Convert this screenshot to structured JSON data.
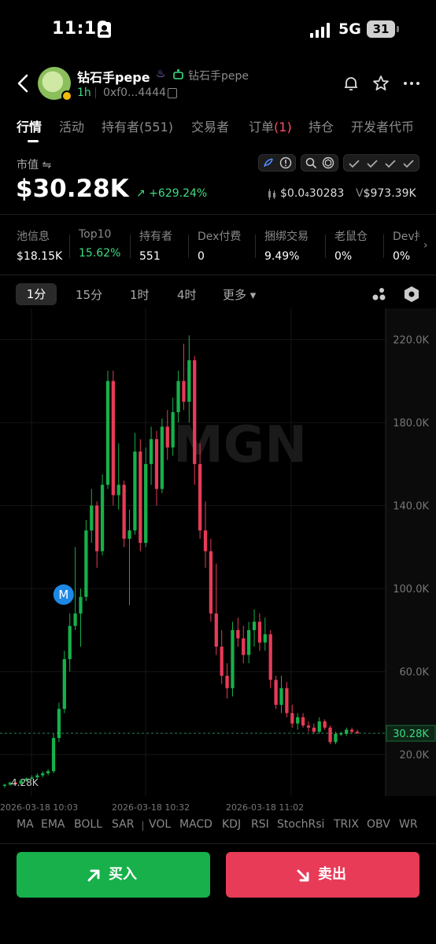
{
  "status_bar": {
    "time": "11:18",
    "network": "5G",
    "battery": "31"
  },
  "header": {
    "token_name": "钻石手pepe",
    "sub_name": "钻石手pepe",
    "age": "1h",
    "address": "0xf0...4444"
  },
  "tabs": [
    {
      "label": "行情"
    },
    {
      "label": "活动"
    },
    {
      "label": "持有者(551)"
    },
    {
      "label": "交易者"
    },
    {
      "label": "订单",
      "count": "(1)"
    },
    {
      "label": "持仓"
    },
    {
      "label": "开发者代币"
    }
  ],
  "market": {
    "label": "市值 ⇋",
    "value": "$30.28K",
    "change": "↗ +629.24%",
    "price": "$0.0₄30283",
    "volume_prefix": "V",
    "volume": "$973.39K"
  },
  "stats": [
    {
      "label": "池信息",
      "value": "$18.15K"
    },
    {
      "label": "Top10",
      "value": "15.62%",
      "highlight": true
    },
    {
      "label": "持有者",
      "value": "551"
    },
    {
      "label": "Dex付费",
      "value": "0"
    },
    {
      "label": "捆绑交易",
      "value": "9.49%"
    },
    {
      "label": "老鼠仓",
      "value": "0%"
    },
    {
      "label": "Dev持",
      "value": "0%"
    }
  ],
  "intervals": [
    "1分",
    "15分",
    "1时",
    "4时",
    "更多 ▾"
  ],
  "chart_data": {
    "type": "candlestick",
    "y_ticks": [
      "220.0K",
      "180.0K",
      "140.0K",
      "100.0K",
      "60.0K",
      "20.0K"
    ],
    "ylim": [
      0,
      235
    ],
    "x_ticks": [
      "2026-03-18 10:03",
      "2026-03-18 10:32",
      "2026-03-18 11:02"
    ],
    "current_price_label": "30.28K",
    "current_price": 30.28,
    "low_label": "4.28K",
    "marker": "M",
    "watermark": "MGN",
    "candles": [
      [
        5,
        6,
        4,
        5.5
      ],
      [
        5.5,
        7,
        5,
        6.5
      ],
      [
        6.5,
        7,
        5.5,
        6
      ],
      [
        6,
        8,
        5.5,
        7.5
      ],
      [
        7.5,
        9,
        7,
        8.5
      ],
      [
        8.5,
        10,
        8,
        9
      ],
      [
        9,
        11,
        8.5,
        10
      ],
      [
        10,
        12,
        9,
        11
      ],
      [
        11,
        13,
        10,
        12
      ],
      [
        12,
        30,
        11,
        28
      ],
      [
        28,
        45,
        26,
        42
      ],
      [
        42,
        70,
        40,
        66
      ],
      [
        66,
        88,
        60,
        82
      ],
      [
        82,
        120,
        80,
        88
      ],
      [
        88,
        100,
        72,
        96
      ],
      [
        96,
        133,
        94,
        128
      ],
      [
        128,
        148,
        122,
        140
      ],
      [
        140,
        142,
        110,
        118
      ],
      [
        118,
        155,
        116,
        150
      ],
      [
        150,
        205,
        148,
        200
      ],
      [
        200,
        205,
        140,
        145
      ],
      [
        145,
        170,
        138,
        150
      ],
      [
        150,
        152,
        120,
        124
      ],
      [
        124,
        138,
        92,
        128
      ],
      [
        128,
        175,
        126,
        166
      ],
      [
        166,
        172,
        118,
        122
      ],
      [
        122,
        168,
        120,
        160
      ],
      [
        160,
        178,
        150,
        172
      ],
      [
        172,
        176,
        140,
        148
      ],
      [
        148,
        182,
        146,
        178
      ],
      [
        178,
        186,
        162,
        168
      ],
      [
        168,
        192,
        164,
        185
      ],
      [
        185,
        205,
        180,
        200
      ],
      [
        200,
        218,
        186,
        190
      ],
      [
        190,
        222,
        180,
        210
      ],
      [
        210,
        212,
        150,
        160
      ],
      [
        160,
        170,
        124,
        128
      ],
      [
        128,
        142,
        110,
        118
      ],
      [
        118,
        124,
        84,
        88
      ],
      [
        88,
        112,
        68,
        72
      ],
      [
        72,
        80,
        54,
        58
      ],
      [
        58,
        64,
        47,
        52
      ],
      [
        52,
        84,
        48,
        80
      ],
      [
        80,
        86,
        72,
        76
      ],
      [
        76,
        82,
        64,
        68
      ],
      [
        68,
        84,
        64,
        80
      ],
      [
        80,
        90,
        72,
        84
      ],
      [
        84,
        88,
        70,
        74
      ],
      [
        74,
        86,
        70,
        78
      ],
      [
        78,
        80,
        52,
        56
      ],
      [
        56,
        58,
        42,
        44
      ],
      [
        44,
        58,
        40,
        52
      ],
      [
        52,
        55,
        38,
        40
      ],
      [
        40,
        44,
        33,
        35
      ],
      [
        35,
        40,
        32,
        38
      ],
      [
        38,
        40,
        33,
        34
      ],
      [
        34,
        36,
        31,
        33
      ],
      [
        33,
        35,
        30,
        31
      ],
      [
        31,
        38,
        30,
        36
      ],
      [
        36,
        37,
        32,
        33
      ],
      [
        33,
        34,
        25,
        26
      ],
      [
        26,
        31,
        25,
        30
      ],
      [
        30,
        31,
        29,
        30.28
      ],
      [
        30,
        33,
        29,
        32
      ],
      [
        32,
        33,
        30,
        31
      ],
      [
        31,
        32,
        30,
        30.28
      ]
    ]
  },
  "indicators": [
    "MA",
    "EMA",
    "BOLL",
    "SAR",
    "VOL",
    "MACD",
    "KDJ",
    "RSI",
    "StochRsi",
    "TRIX",
    "OBV",
    "WR"
  ],
  "actions": {
    "buy": "买入",
    "sell": "卖出"
  },
  "colors": {
    "up": "#17b04a",
    "down": "#e73b57",
    "accent_green": "#3ddc84"
  }
}
